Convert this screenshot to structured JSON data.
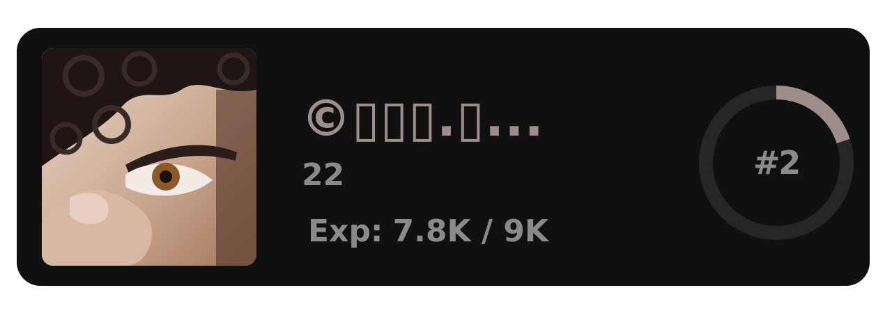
{
  "profile": {
    "name": "©▯▯▯.▯...",
    "level": "22",
    "exp_label": "Exp:",
    "exp_value": "7.8K / 9K",
    "exp_current": 7800,
    "exp_max": 9000,
    "rank_label": "#2",
    "rank_progress": 0.2
  },
  "colors": {
    "card_bg": "#101010",
    "name": "#9d8e8c",
    "text_muted": "#8a8a8a",
    "ring_track": "#262626",
    "ring_fill": "#9d8e8c"
  },
  "icons": {
    "avatar": "user-photo"
  }
}
